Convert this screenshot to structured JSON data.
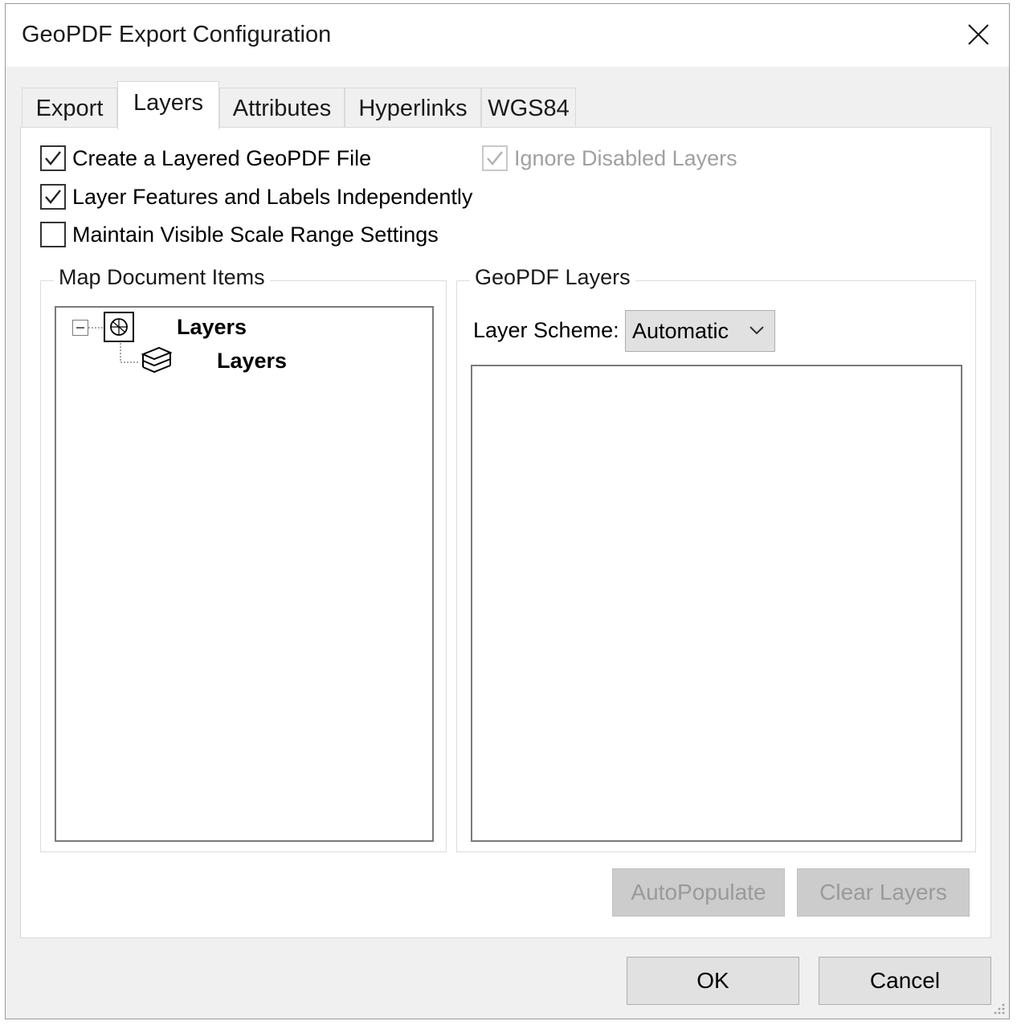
{
  "window": {
    "title": "GeoPDF Export Configuration"
  },
  "tabs": [
    {
      "label": "Export",
      "active": false
    },
    {
      "label": "Layers",
      "active": true
    },
    {
      "label": "Attributes",
      "active": false
    },
    {
      "label": "Hyperlinks",
      "active": false
    },
    {
      "label": "WGS84",
      "active": false
    }
  ],
  "options": {
    "create_layered": {
      "label": "Create a Layered GeoPDF File",
      "checked": true
    },
    "layer_features": {
      "label": "Layer Features and Labels Independently",
      "checked": true
    },
    "maintain_scale": {
      "label": "Maintain Visible Scale Range Settings",
      "checked": false
    },
    "ignore_disabled": {
      "label": "Ignore Disabled Layers",
      "checked": true,
      "disabled": true
    }
  },
  "map_document": {
    "label": "Map Document Items",
    "tree": [
      {
        "label": "Layers",
        "icon": "map-frame-icon",
        "expanded": true
      },
      {
        "label": "Layers",
        "icon": "layers-icon"
      }
    ]
  },
  "geopdf_layers": {
    "label": "GeoPDF Layers",
    "scheme_label": "Layer Scheme:",
    "scheme_value": "Automatic"
  },
  "buttons": {
    "autopopulate": "AutoPopulate",
    "clear_layers": "Clear Layers",
    "ok": "OK",
    "cancel": "Cancel"
  }
}
